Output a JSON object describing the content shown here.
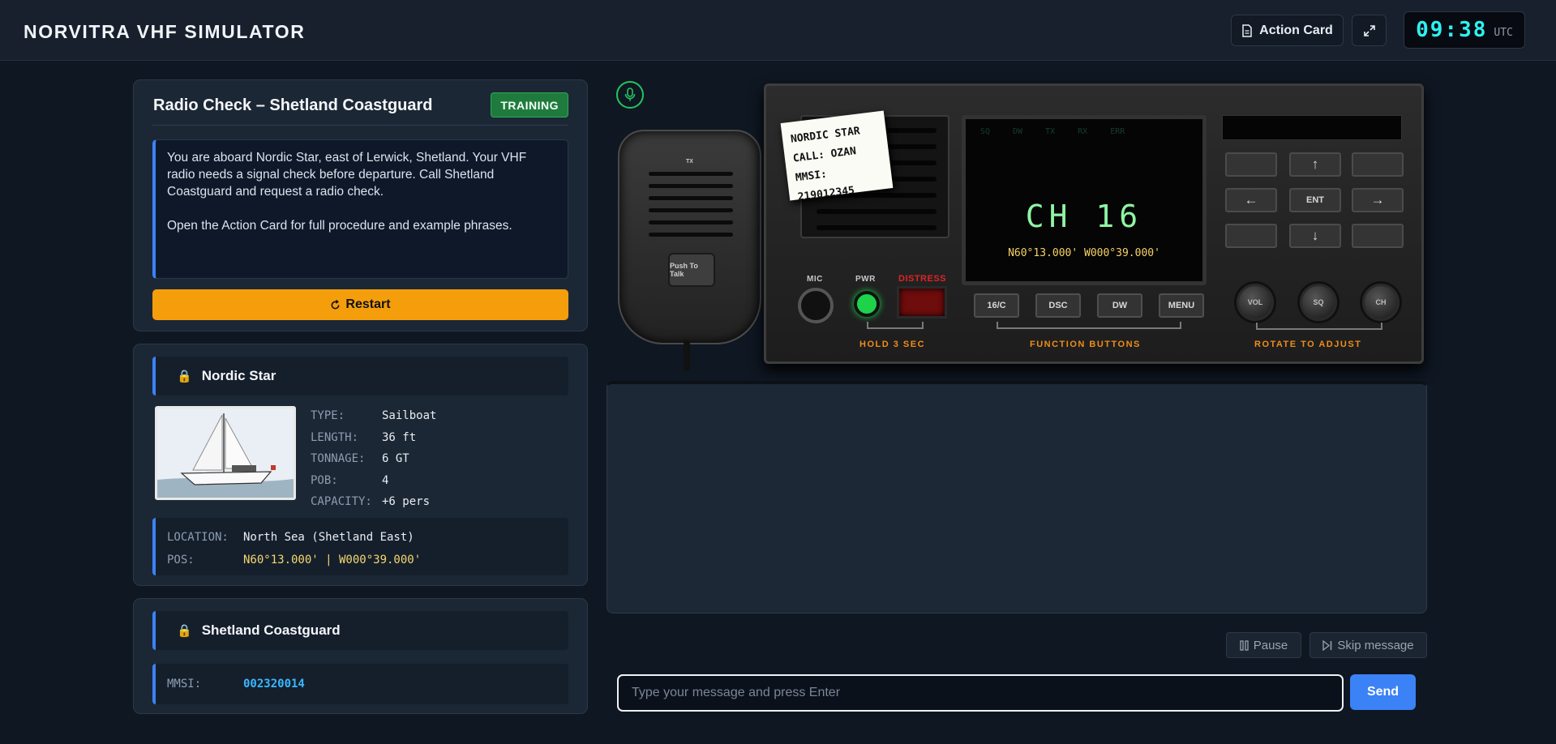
{
  "header": {
    "title": "NORVITRA VHF SIMULATOR",
    "action_card_label": "Action Card",
    "clock_time": "09:38",
    "clock_zone": "UTC"
  },
  "scenario": {
    "title": "Radio Check – Shetland Coastguard",
    "badge": "TRAINING",
    "brief_1": "You are aboard Nordic Star, east of Lerwick, Shetland. Your VHF radio needs a signal check before departure. Call Shetland Coastguard and request a radio check.",
    "brief_2": "Open the Action Card for full procedure and example phrases.",
    "restart_label": "Restart"
  },
  "vessel": {
    "name": "Nordic Star",
    "specs": [
      {
        "key": "TYPE:",
        "value": "Sailboat"
      },
      {
        "key": "LENGTH:",
        "value": "36 ft"
      },
      {
        "key": "TONNAGE:",
        "value": "6 GT"
      },
      {
        "key": "POB:",
        "value": "4"
      },
      {
        "key": "CAPACITY:",
        "value": "+6 pers"
      }
    ],
    "location_key": "LOCATION:",
    "location_value": "North Sea (Shetland East)",
    "pos_key": "POS:",
    "pos_value": "N60°13.000' | W000°39.000'"
  },
  "coastguard": {
    "name": "Shetland Coastguard",
    "mmsi_key": "MMSI:",
    "mmsi_value": "002320014"
  },
  "radio": {
    "note_lines": [
      "NORDIC STAR",
      "CALL: OZAN",
      "MMSI: 219012345"
    ],
    "ptt_label": "Push To Talk",
    "tx_label": "TX",
    "lcd_status": [
      "SQ",
      "DW",
      "TX",
      "RX",
      "ERR"
    ],
    "lcd_channel": "CH 16",
    "lcd_position": "N60°13.000' W000°39.000'",
    "ent_label": "ENT",
    "mic_label": "MIC",
    "pwr_label": "PWR",
    "distress_label": "DISTRESS",
    "function_keys": [
      "16/C",
      "DSC",
      "DW",
      "MENU"
    ],
    "knobs": [
      "VOL",
      "SQ",
      "CH"
    ],
    "hold_label": "HOLD 3 SEC",
    "function_label": "FUNCTION BUTTONS",
    "rotate_label": "ROTATE TO ADJUST"
  },
  "controls": {
    "pause_label": "Pause",
    "skip_label": "Skip message",
    "input_placeholder": "Type your message and press Enter",
    "send_label": "Send"
  },
  "colors": {
    "accent": "#3b82f6",
    "restart": "#f59e0b",
    "badge": "#1f7a3e",
    "clock": "#2ef1f1"
  }
}
